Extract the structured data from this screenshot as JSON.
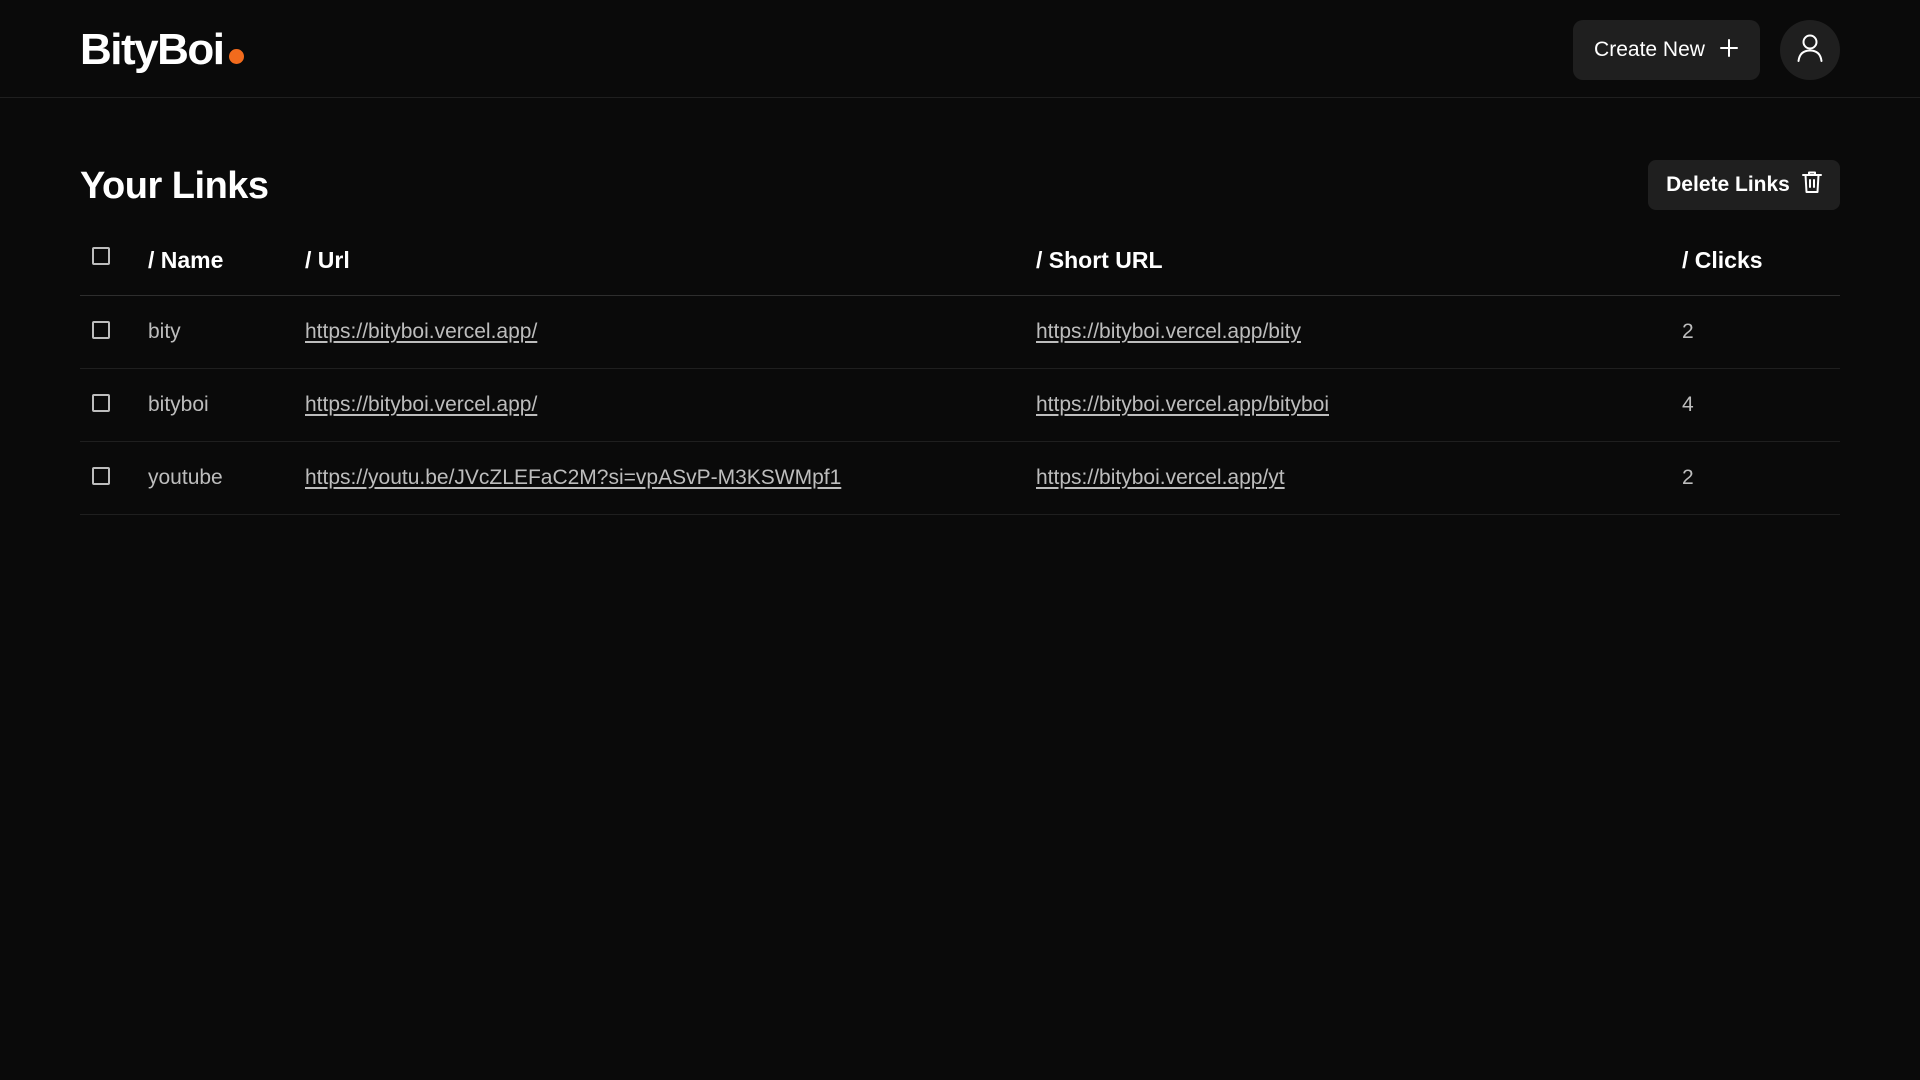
{
  "header": {
    "logo_text": "BityBoi",
    "logo_dot_color": "#f26b1d",
    "create_label": "Create New",
    "create_icon": "plus-icon",
    "avatar_icon": "user-icon"
  },
  "main": {
    "title": "Your Links",
    "delete_label": "Delete Links",
    "delete_icon": "trash-icon"
  },
  "table": {
    "columns": [
      "/ Name",
      "/ Url",
      "/ Short URL",
      "/ Clicks"
    ],
    "rows": [
      {
        "name": "bity",
        "url": "https://bityboi.vercel.app/",
        "short_url": "https://bityboi.vercel.app/bity",
        "clicks": "2",
        "checked": false
      },
      {
        "name": "bityboi",
        "url": "https://bityboi.vercel.app/",
        "short_url": "https://bityboi.vercel.app/bityboi",
        "clicks": "4",
        "checked": false
      },
      {
        "name": "youtube",
        "url": "https://youtu.be/JVcZLEFaC2M?si=vpASvP-M3KSWMpf1",
        "short_url": "https://bityboi.vercel.app/yt",
        "clicks": "2",
        "checked": false
      }
    ]
  }
}
